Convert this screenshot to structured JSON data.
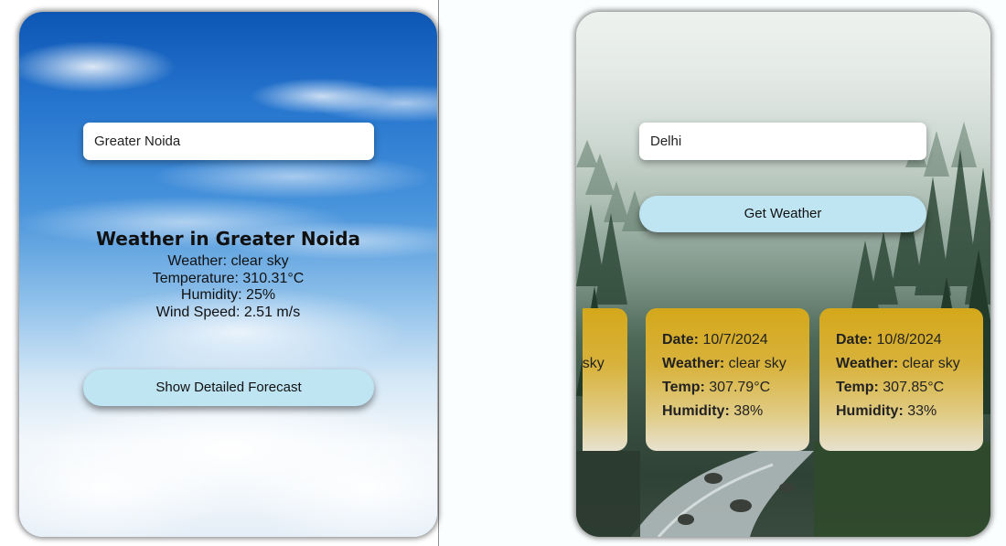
{
  "left_card": {
    "city_input_value": "Greater Noida",
    "heading": "Weather in Greater Noida",
    "lines": {
      "weather": "Weather: clear sky",
      "temperature": "Temperature: 310.31°C",
      "humidity": "Humidity: 25%",
      "wind": "Wind Speed: 2.51 m/s"
    },
    "button_label": "Show Detailed Forecast"
  },
  "right_card": {
    "city_input_value": "Delhi",
    "button_label": "Get Weather",
    "labels": {
      "date": "Date:",
      "weather": "Weather:",
      "temp": "Temp:",
      "humidity": "Humidity:"
    },
    "forecast": [
      {
        "date": "",
        "weather": "clear sky",
        "temp": "",
        "humidity": ""
      },
      {
        "date": "10/7/2024",
        "weather": "clear sky",
        "temp": "307.79°C",
        "humidity": "38%"
      },
      {
        "date": "10/8/2024",
        "weather": "clear sky",
        "temp": "307.85°C",
        "humidity": "33%"
      }
    ]
  },
  "colors": {
    "button_bg": "#bfe5f3",
    "forecast_card_top": "#d4a81a",
    "forecast_card_bottom": "#e8e2cf"
  }
}
